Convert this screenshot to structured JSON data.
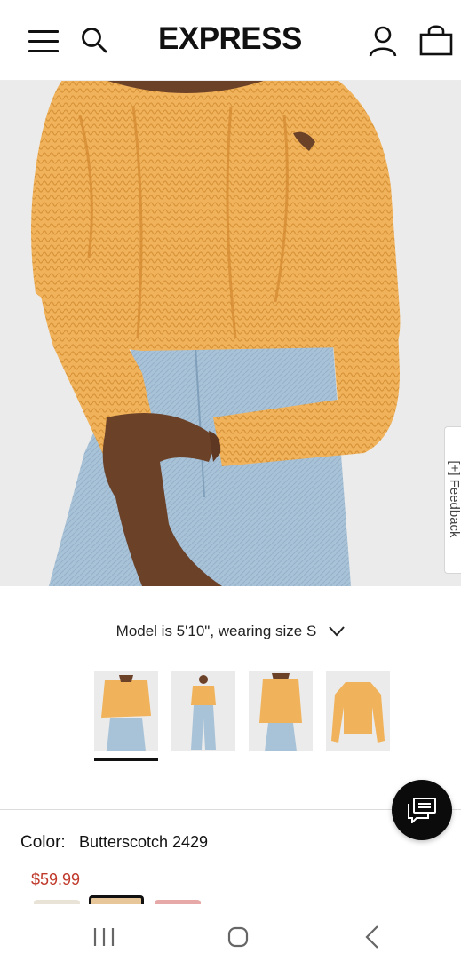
{
  "header": {
    "brand": "EXPRESS",
    "icons": [
      "menu-icon",
      "search-icon",
      "account-icon",
      "shopping-bag-icon"
    ]
  },
  "hero": {
    "image_subject": "model wearing butterscotch cable knit sweater with jeans",
    "feedback_label": "[+] Feedback"
  },
  "product": {
    "model_info": "Model is 5'10\", wearing size S",
    "color_label": "Color:",
    "color_value": "Butterscotch 2429",
    "price": "$59.99",
    "thumbnails": [
      "front view",
      "full length view",
      "back view",
      "flat lay"
    ],
    "selected_thumbnail": 0
  },
  "colors": {
    "accent": "#111111",
    "price": "#c0392b",
    "sweater": "#f2b55e"
  }
}
